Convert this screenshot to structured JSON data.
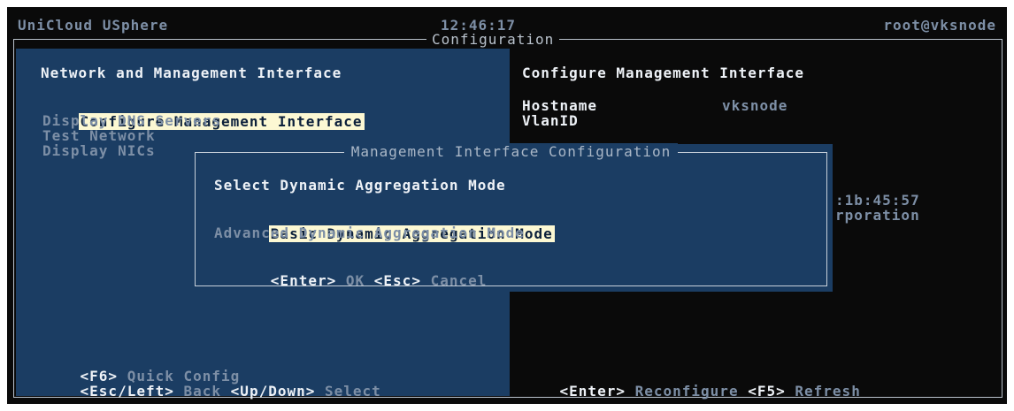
{
  "header": {
    "app_name": "UniCloud USphere",
    "clock": "12:46:17",
    "user": "root@vksnode"
  },
  "frame_title": "Configuration",
  "left_panel": {
    "title": "Network and Management Interface",
    "menu": [
      {
        "label": "Configure Management Interface",
        "selected": true
      },
      {
        "label": "Display DNS Servers",
        "selected": false
      },
      {
        "label": "Test Network",
        "selected": false
      },
      {
        "label": "Display NICs",
        "selected": false
      }
    ],
    "footer": {
      "f6_key": "<F6>",
      "f6_label": "Quick Config",
      "back_key": "<Esc/Left>",
      "back_label": "Back",
      "select_key": "<Up/Down>",
      "select_label": "Select"
    }
  },
  "right_panel": {
    "title": "Configure Management Interface",
    "fields": [
      {
        "label": "Hostname",
        "value": "vksnode"
      },
      {
        "label": "VlanID",
        "value": ""
      }
    ],
    "partial_lines": [
      ":1b:45:57",
      "rporation"
    ],
    "footer": {
      "enter_key": "<Enter>",
      "enter_label": "Reconfigure",
      "f5_key": "<F5>",
      "f5_label": "Refresh"
    }
  },
  "dialog": {
    "title": "Management Interface Configuration",
    "prompt": "Select Dynamic Aggregation Mode",
    "options": [
      {
        "label": "Basic Dynamic Aggregation Mode",
        "selected": true
      },
      {
        "label": "Advanced Dynamic Aggregation Mode",
        "selected": false
      }
    ],
    "footer": {
      "enter_key": "<Enter>",
      "ok_label": "OK",
      "esc_key": "<Esc>",
      "cancel_label": "Cancel"
    }
  },
  "colors": {
    "panel_bg": "#1b3d63",
    "screen_bg": "#0a0a0a",
    "highlight_bg": "#fcf8d3",
    "muted_text": "#7d8fa6",
    "bright_text": "#eef2f7"
  }
}
